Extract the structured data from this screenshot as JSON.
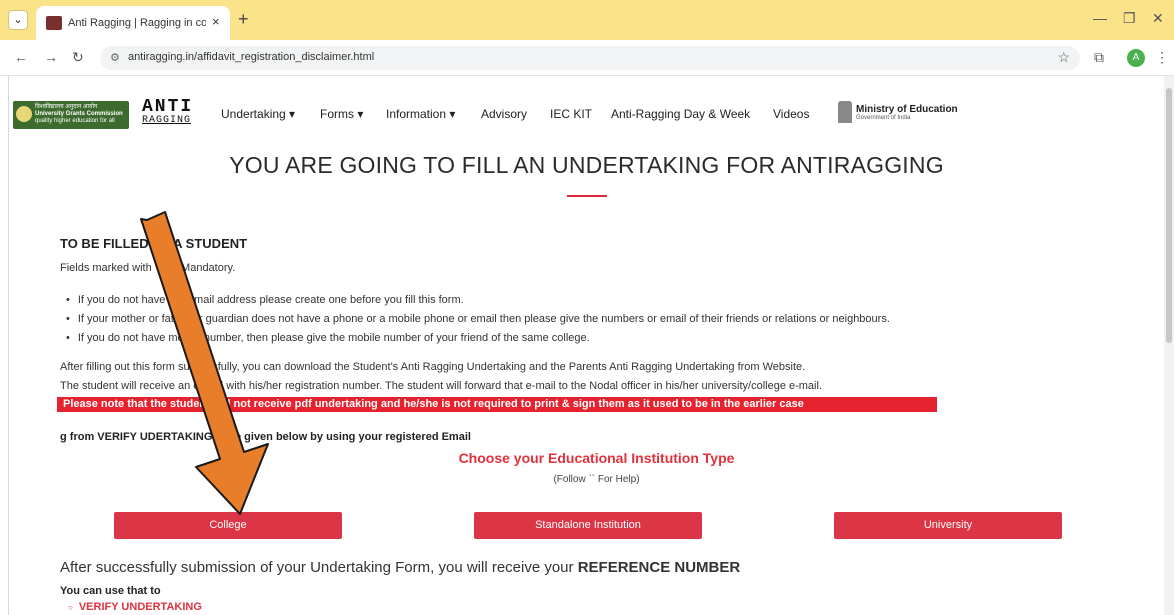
{
  "browser": {
    "tab_title": "Anti Ragging | Ragging in colle",
    "tab_close": "×",
    "new_tab": "+",
    "url": "antiragging.in/affidavit_registration_disclaimer.html",
    "avatar_initial": "A"
  },
  "header": {
    "ugc_logo_line1": "विश्वविद्यालय अनुदान आयोग",
    "ugc_logo_line2": "University Grants Commission",
    "ugc_logo_line3": "quality higher education for all",
    "anti_logo_top": "ANTI",
    "anti_logo_bottom": "RAGGING",
    "nav": [
      "Undertaking ▾",
      "Forms ▾",
      "Information ▾",
      "Advisory",
      "IEC KIT",
      "Anti-Ragging Day & Week",
      "Videos"
    ],
    "ministry_title": "Ministry of Education",
    "ministry_sub": "Government of India"
  },
  "main": {
    "heading": "YOU ARE GOING TO FILL AN UNDERTAKING FOR ANTIRAGGING",
    "section_title": "TO BE FILLED BY A STUDENT",
    "fields_note": "Fields marked with * are Mandatory.",
    "bullets": [
      "If you do not have an E mail address please create one before you fill this form.",
      "If your mother or father or guardian does not have a phone or a mobile phone or email then please give the numbers or email of their friends or relations or neighbours.",
      "If you do not have mobile number, then please give the mobile number of your friend of the same college."
    ],
    "para1": "After filling out this form successfully, you can download the Student's Anti Ragging Undertaking and the Parents Anti Ragging Undertaking from Website.",
    "para2": "The student will receive an e-mail with his/her registration number. The student will forward that e-mail to the Nodal officer in his/her university/college e-mail.",
    "notice": "Please note that the student will not receive pdf undertaking and he/she is not required to print & sign them as it used to be in the earlier case",
    "verify_hint": "g from VERIFY UDERTAKING page given below by using your registered Email",
    "choose_title": "Choose your Educational Institution Type",
    "help_text": "(Follow `` For Help)",
    "buttons": [
      "College",
      "Standalone Institution",
      "University"
    ],
    "after_text_pre": "After successfully submission of your Undertaking Form, you will receive your ",
    "after_text_bold": "REFERENCE NUMBER",
    "use_that": "You can use that to",
    "verify_link": "VERIFY UNDERTAKING"
  },
  "colors": {
    "accent_red": "#dc3545",
    "tabbar_yellow": "#fbe38a",
    "annotation_arrow": "#e87d2a"
  }
}
